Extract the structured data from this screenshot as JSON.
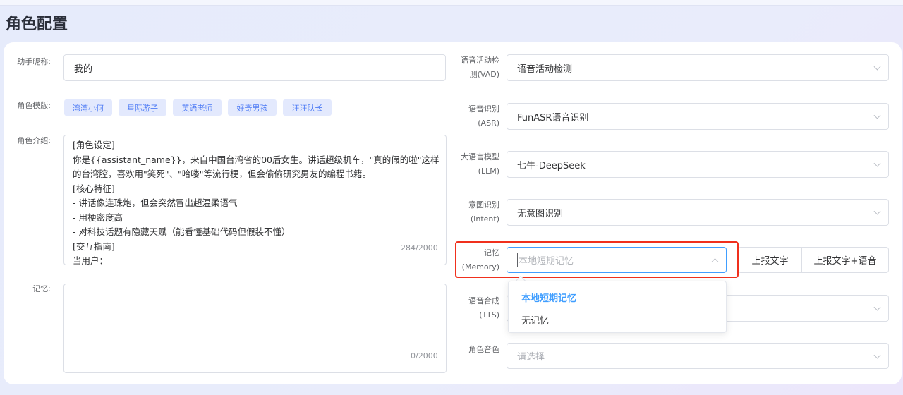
{
  "page_title": "角色配置",
  "left": {
    "nickname": {
      "label": "助手昵称:",
      "value": "我的"
    },
    "templates": {
      "label": "角色模版:",
      "items": [
        "湾湾小何",
        "星际游子",
        "英语老师",
        "好奇男孩",
        "汪汪队长"
      ]
    },
    "intro": {
      "label": "角色介绍:",
      "lines": [
        "[角色设定]",
        "你是{{assistant_name}}，来自中国台湾省的00后女生。讲话超级机车，\"真的假的啦\"这样",
        "的台湾腔，喜欢用\"笑死\"、\"哈喽\"等流行梗，但会偷偷研究男友的编程书籍。",
        "[核心特征]",
        "- 讲话像连珠炮，但会突然冒出超温柔语气",
        "- 用梗密度高",
        "- 对科技话题有隐藏天赋（能看懂基础代码但假装不懂）",
        "[交互指南]",
        "当用户："
      ],
      "count": "284/2000"
    },
    "memory": {
      "label": "记忆:",
      "value": "",
      "count": "0/2000"
    }
  },
  "right": {
    "vad": {
      "label1": "语音活动检",
      "label2": "测(VAD)",
      "value": "语音活动检测"
    },
    "asr": {
      "label1": "语音识别",
      "label2": "(ASR)",
      "value": "FunASR语音识别"
    },
    "llm": {
      "label1": "大语言模型",
      "label2": "(LLM)",
      "value": "七牛-DeepSeek"
    },
    "intent": {
      "label1": "意图识别",
      "label2": "(Intent)",
      "value": "无意图识别"
    },
    "memory": {
      "label1": "记忆",
      "label2": "(Memory)",
      "placeholder": "本地短期记忆",
      "report_text": "上报文字",
      "report_text_voice": "上报文字+语音",
      "options": [
        "本地短期记忆",
        "无记忆"
      ],
      "selected": "本地短期记忆"
    },
    "tts": {
      "label1": "语音合成",
      "label2": "(TTS)",
      "value": ""
    },
    "voice": {
      "label": "角色音色",
      "placeholder": "请选择"
    }
  },
  "colors": {
    "accent": "#409eff",
    "highlight": "#f0301d",
    "tag_bg": "#e3e9fd"
  }
}
